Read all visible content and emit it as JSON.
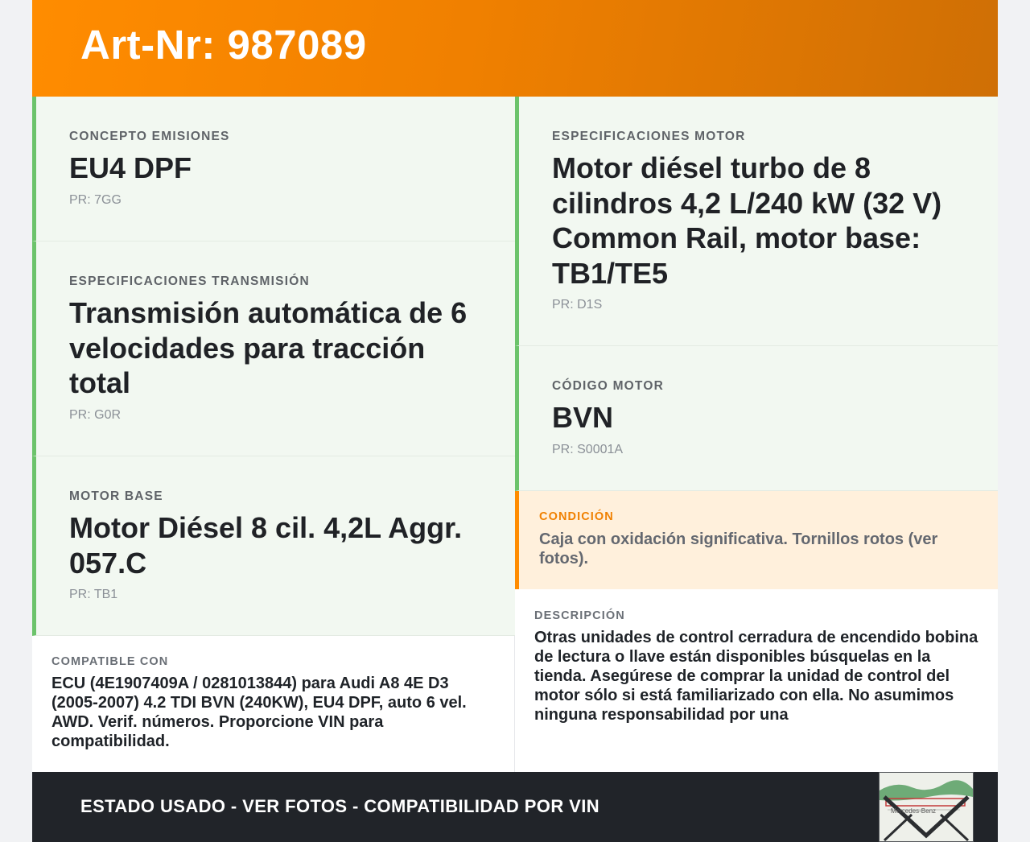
{
  "header": {
    "title": "Art-Nr: 987089"
  },
  "left_specs": [
    {
      "label": "CONCEPTO EMISIONES",
      "value": "EU4 DPF",
      "pr": "PR: 7GG"
    },
    {
      "label": "ESPECIFICACIONES TRANSMISIÓN",
      "value": "Transmisión automática de 6 velocidades para tracción total",
      "pr": "PR: G0R"
    },
    {
      "label": "MOTOR BASE",
      "value": "Motor Diésel 8 cil. 4,2L Aggr. 057.C",
      "pr": "PR: TB1"
    }
  ],
  "right_specs": [
    {
      "label": "ESPECIFICACIONES MOTOR",
      "value": "Motor diésel turbo de 8 cilindros 4,2 L/240 kW (32 V) Common Rail, motor base: TB1/TE5",
      "pr": "PR: D1S"
    },
    {
      "label": "CÓDIGO MOTOR",
      "value": "BVN",
      "pr": "PR: S0001A"
    }
  ],
  "condition": {
    "label": "CONDICIÓN",
    "text": "Caja con oxidación significativa. Tornillos rotos (ver fotos)."
  },
  "compatible": {
    "label": "COMPATIBLE CON",
    "text": "ECU (4E1907409A / 0281013844) para Audi A8 4E D3 (2005-2007) 4.2 TDI BVN (240KW), EU4 DPF, auto 6 vel. AWD. Verif. números. Proporcione VIN para compatibilidad."
  },
  "description": {
    "label": "DESCRIPCIÓN",
    "text": "Otras unidades de control cerradura de encendido bobina de lectura o llave están disponibles búsquelas en la tienda. Asegúrese de comprar la unidad de control del motor sólo si está familiarizado con ella. No asumimos ninguna responsabilidad por una"
  },
  "footer": {
    "text": "ESTADO USADO - VER FOTOS - COMPATIBILIDAD POR VIN",
    "thumbnail_text": "Mercedes-Benz"
  },
  "colors": {
    "accent": "#ff8c00",
    "spec_border": "#6cc36b",
    "spec_bg": "#f2f8f1",
    "condition_bg": "#fff0dc",
    "footer_bg": "#212429"
  }
}
